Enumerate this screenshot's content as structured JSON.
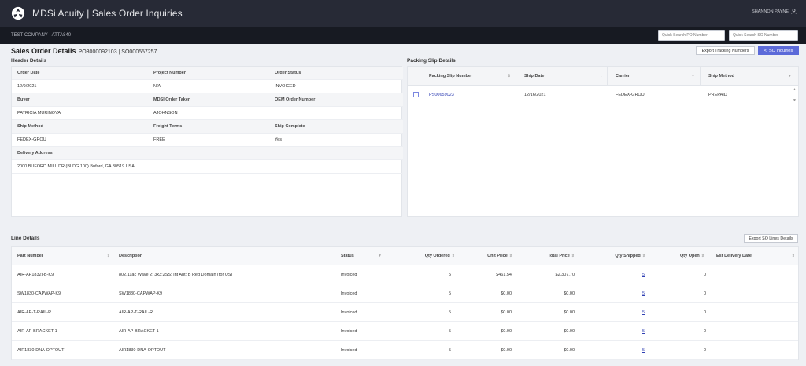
{
  "app": {
    "title": "MDSi Acuity | Sales Order Inquiries",
    "user": "SHANNON PAYNE",
    "company": "TEST COMPANY - ATTA840"
  },
  "search": {
    "po_placeholder": "Quick Search PO Number",
    "so_placeholder": "Quick Search SO Number"
  },
  "page": {
    "title": "Sales Order Details",
    "ids": "PO3000092103 | SO000557257",
    "export_tracking": "Export Tracking Numbers",
    "so_inquiries": "SO Inquiries"
  },
  "header_details": {
    "section_title": "Header Details",
    "order_date_label": "Order Date",
    "order_date": "12/9/2021",
    "project_number_label": "Project Number",
    "project_number": "N/A",
    "order_status_label": "Order Status",
    "order_status": "INVOICED",
    "buyer_label": "Buyer",
    "buyer": "PATRICIA MURINOVA",
    "order_taker_label": "MDSI Order Taker",
    "order_taker": "AJOHNSON",
    "oem_label": "OEM Order Number",
    "oem": "",
    "ship_method_label": "Ship Method",
    "ship_method": "FEDEX-GROU",
    "freight_label": "Freight Terms",
    "freight": "FREE",
    "ship_complete_label": "Ship Complete",
    "ship_complete": "Yes",
    "delivery_label": "Delivery Address",
    "delivery": "2000 BUFORD MILL DR (BLDG 100) Buford, GA 30519 USA"
  },
  "packing_slip": {
    "section_title": "Packing Slip Details",
    "columns": [
      "Packing Slip Number",
      "Ship Date",
      "Carrier",
      "Ship Method"
    ],
    "rows": [
      {
        "number": "PS00659023",
        "ship_date": "12/16/2021",
        "carrier": "FEDEX-GROU",
        "method": "PREPAID"
      }
    ]
  },
  "line_details": {
    "section_title": "Line Details",
    "export_label": "Export SO Lines Details",
    "columns": [
      "Part Number",
      "Description",
      "Status",
      "Qty Ordered",
      "Unit Price",
      "Total Price",
      "Qty Shipped",
      "Qty Open",
      "Est Delivery Date"
    ],
    "rows": [
      {
        "part": "AIR-AP1832I-B-K9",
        "desc": "802.11ac Wave 2; 3x3:2SS; Int Ant; B Reg Domain (for US)",
        "status": "Invoiced",
        "qty_ordered": "5",
        "unit_price": "$461.54",
        "total_price": "$2,307.70",
        "qty_shipped": "5",
        "qty_open": "0",
        "est": ""
      },
      {
        "part": "SW1830-CAPWAP-K9",
        "desc": "SW1830-CAPWAP-K9",
        "status": "Invoiced",
        "qty_ordered": "5",
        "unit_price": "$0.00",
        "total_price": "$0.00",
        "qty_shipped": "5",
        "qty_open": "0",
        "est": ""
      },
      {
        "part": "AIR-AP-T-RAIL-R",
        "desc": "AIR-AP-T-RAIL-R",
        "status": "Invoiced",
        "qty_ordered": "5",
        "unit_price": "$0.00",
        "total_price": "$0.00",
        "qty_shipped": "5",
        "qty_open": "0",
        "est": ""
      },
      {
        "part": "AIR-AP-BRACKET-1",
        "desc": "AIR-AP-BRACKET-1",
        "status": "Invoiced",
        "qty_ordered": "5",
        "unit_price": "$0.00",
        "total_price": "$0.00",
        "qty_shipped": "5",
        "qty_open": "0",
        "est": ""
      },
      {
        "part": "AIR1830-DNA-OPTOUT",
        "desc": "AIR1830-DNA-OPTOUT",
        "status": "Invoiced",
        "qty_ordered": "5",
        "unit_price": "$0.00",
        "total_price": "$0.00",
        "qty_shipped": "5",
        "qty_open": "0",
        "est": ""
      }
    ]
  },
  "colors": {
    "topbar": "#272a36",
    "subbar": "#171a22",
    "accent": "#5b6ad9",
    "link": "#2f3fb3"
  }
}
